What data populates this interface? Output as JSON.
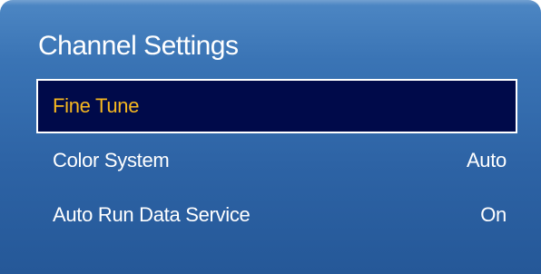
{
  "panel": {
    "title": "Channel Settings"
  },
  "menu": {
    "items": [
      {
        "label": "Fine Tune",
        "value": "",
        "selected": true
      },
      {
        "label": "Color System",
        "value": "Auto",
        "selected": false
      },
      {
        "label": "Auto Run Data Service",
        "value": "On",
        "selected": false
      }
    ]
  },
  "colors": {
    "panel_top": "#4d87c4",
    "panel_bottom": "#255898",
    "selected_bg": "#000a4a",
    "selected_text": "#f7b81f",
    "text": "#ffffff"
  }
}
